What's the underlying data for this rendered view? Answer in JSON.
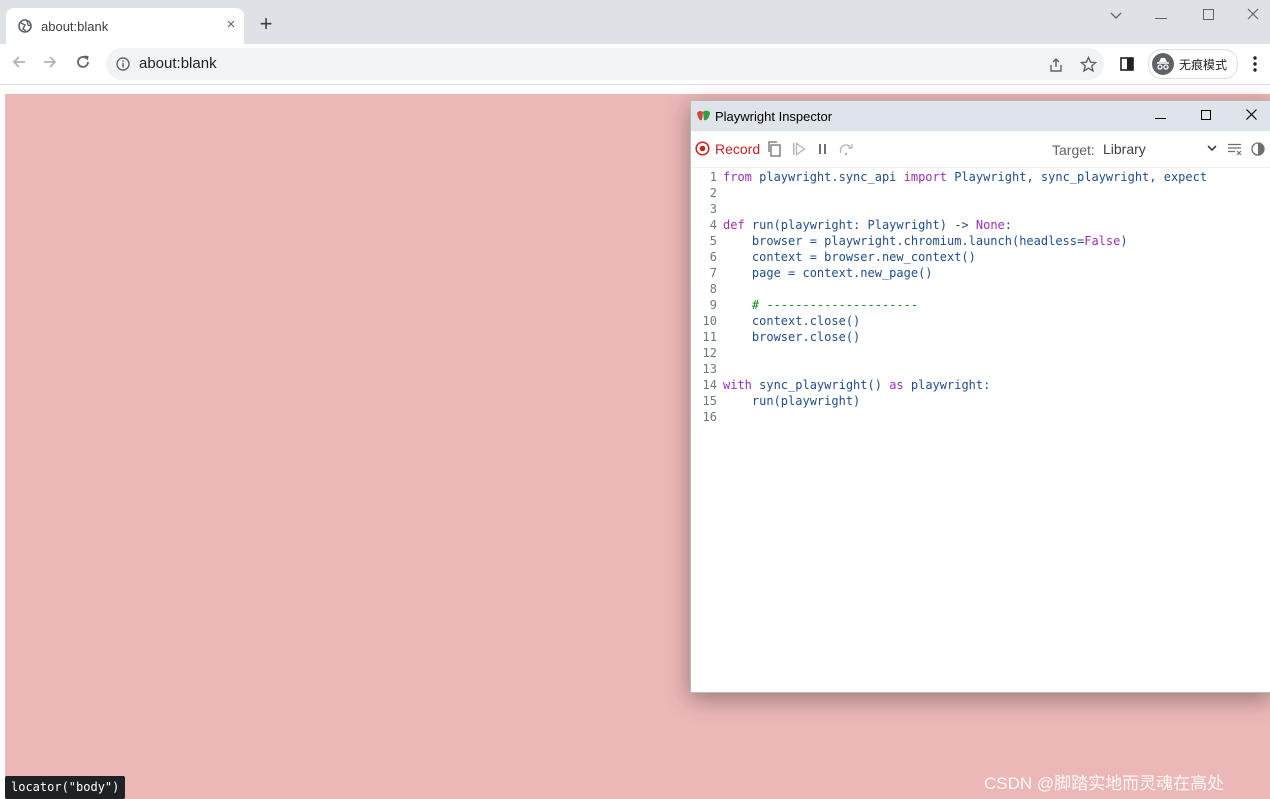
{
  "browser": {
    "tab_title": "about:blank",
    "tab_close": "×",
    "new_tab": "+",
    "address": "about:blank",
    "incognito_label": "无痕模式"
  },
  "page": {
    "background": "#ecb7b7",
    "locator_tooltip": "locator(\"body\")",
    "watermark": "CSDN @脚踏实地而灵魂在高处"
  },
  "inspector": {
    "title": "Playwright Inspector",
    "record_label": "Record",
    "target_label": "Target:",
    "target_value": "Library",
    "record_color": "#c5221f",
    "code_lines": [
      {
        "n": "1",
        "t": "from playwright.sync_api import Playwright, sync_playwright, expect"
      },
      {
        "n": "2",
        "t": ""
      },
      {
        "n": "3",
        "t": ""
      },
      {
        "n": "4",
        "t": "def run(playwright: Playwright) -> None:"
      },
      {
        "n": "5",
        "t": "    browser = playwright.chromium.launch(headless=False)"
      },
      {
        "n": "6",
        "t": "    context = browser.new_context()"
      },
      {
        "n": "7",
        "t": "    page = context.new_page()"
      },
      {
        "n": "8",
        "t": ""
      },
      {
        "n": "9",
        "t": "    # ---------------------"
      },
      {
        "n": "10",
        "t": "    context.close()"
      },
      {
        "n": "11",
        "t": "    browser.close()"
      },
      {
        "n": "12",
        "t": ""
      },
      {
        "n": "13",
        "t": ""
      },
      {
        "n": "14",
        "t": "with sync_playwright() as playwright:"
      },
      {
        "n": "15",
        "t": "    run(playwright)"
      },
      {
        "n": "16",
        "t": ""
      }
    ]
  }
}
